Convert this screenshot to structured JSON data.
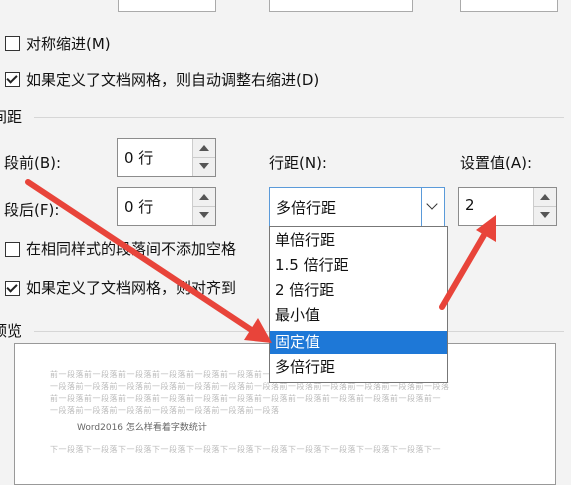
{
  "options": {
    "mirror_indents": "对称缩进(M)",
    "auto_adjust_right_indent": "如果定义了文档网格，则自动调整右缩进(D)",
    "no_space_same_style": "在相同样式的段落间不添加空格",
    "snap_to_grid": "如果定义了文档网格，则对齐到"
  },
  "spacing": {
    "section_title": "间距",
    "before_label": "段前(B):",
    "before_value": "0 行",
    "after_label": "段后(F):",
    "after_value": "0 行",
    "line_spacing_label": "行距(N):",
    "line_spacing_value": "多倍行距",
    "set_value_label": "设置值(A):",
    "set_value": "2"
  },
  "dropdown": {
    "items": [
      "单倍行距",
      "1.5 倍行距",
      "2 倍行距",
      "最小值",
      "固定值",
      "多倍行距"
    ],
    "highlighted": "固定值"
  },
  "preview": {
    "section_title": "预览",
    "prev_line_1": "前一段落前一段落前一段落前一段落前一段落前一段落前一段落前一段落前一段落前一段落前一段落前一",
    "prev_line_2": "一段落前一段落前一段落前一段落前一段落前一段落前一段落前一段落前一段落前一段落前一段落前一段落",
    "prev_line_3": "前一段落前一段落前一段落前一段落前一段落前一段落前一段落前一段落前一段落前一段落前一段落前一",
    "prev_line_4": "一段落前一段落前一段落前一段落前一段落前一段落前一段落",
    "sample_text": "Word2016 怎么样看着字数统计",
    "next_line_1": "下一段落下一段落下一段落下一段落下一段落下一段落下一段落下一段落下一段落下一段落下一段落下一"
  },
  "colors": {
    "highlight": "#1e78d7",
    "arrow": "#e8443a"
  }
}
